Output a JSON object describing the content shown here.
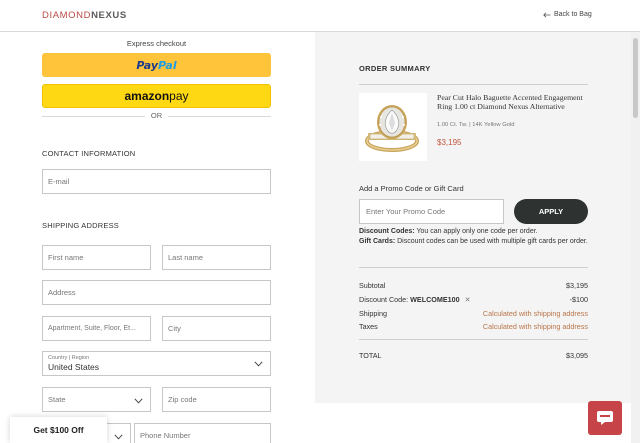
{
  "brand": {
    "part1": "DIAMOND",
    "part2": "NEXUS"
  },
  "header": {
    "back_label": "Back to Bag"
  },
  "express": {
    "title": "Express checkout",
    "paypal_a": "Pay",
    "paypal_b": "Pal",
    "amazon_a": "amazon",
    "amazon_b": " pay",
    "or": "OR"
  },
  "contact": {
    "heading": "CONTACT INFORMATION",
    "email_placeholder": "E-mail"
  },
  "shipping": {
    "heading": "SHIPPING ADDRESS",
    "first_name": "First name",
    "last_name": "Last name",
    "address": "Address",
    "apartment": "Apartment, Suite, Floor, Et...",
    "city": "City",
    "country_label": "Country | Region",
    "country_value": "United States",
    "state": "State",
    "zip": "Zip code",
    "phone": "Phone Number"
  },
  "summary": {
    "title": "ORDER SUMMARY",
    "product": {
      "name": "Pear Cut Halo Baguette Accented Engagement Ring 1.00 ct Diamond Nexus Alternative",
      "spec": "1.00 Ct. Tw. | 14K Yellow Gold",
      "price": "$3,195"
    },
    "promo_label": "Add a Promo Code or Gift Card",
    "promo_placeholder": "Enter Your Promo Code",
    "apply_label": "APPLY",
    "note1_bold": "Discount Codes:",
    "note1_text": " You can apply only one code per order.",
    "note2_bold": "Gift Cards:",
    "note2_text": " Discount codes can be used with multiple gift cards per order.",
    "subtotal_label": "Subtotal",
    "subtotal_value": "$3,195",
    "discount_label": "Discount Code: ",
    "discount_code": "WELCOME100",
    "discount_value": "-$100",
    "shipping_label": "Shipping",
    "shipping_value": "Calculated with shipping address",
    "taxes_label": "Taxes",
    "taxes_value": "Calculated with shipping address",
    "total_label": "TOTAL",
    "total_value": "$3,095"
  },
  "offer": {
    "label": "Get $100 Off"
  },
  "colors": {
    "brand_red": "#b94b45",
    "paypal_yellow": "#ffc439",
    "amazon_yellow": "#ffd814",
    "apply_dark": "#2e3230",
    "price_orange": "#c0573f",
    "chat_red": "#c64448"
  }
}
